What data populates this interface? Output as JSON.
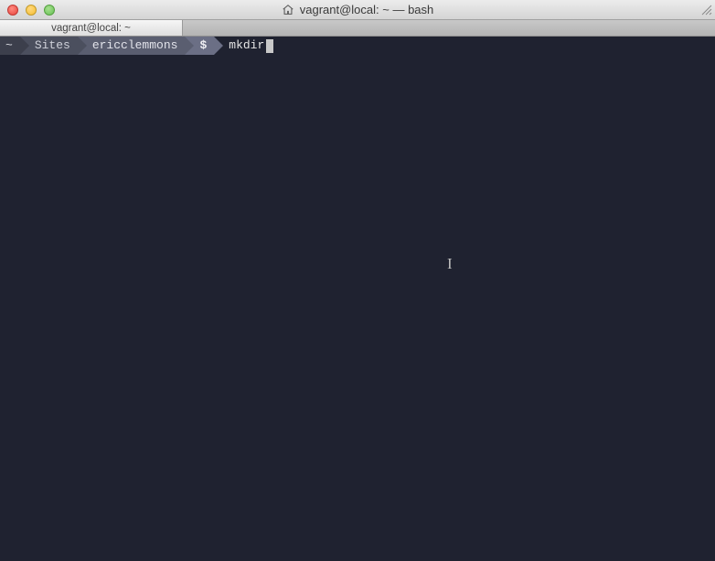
{
  "window": {
    "title": "vagrant@local: ~ — bash"
  },
  "tabs": {
    "active": {
      "label": "vagrant@local: ~"
    }
  },
  "prompt": {
    "seg1": "~",
    "seg2": "Sites",
    "seg3": "ericclemmons",
    "seg4": "$",
    "command": "mkdir"
  }
}
